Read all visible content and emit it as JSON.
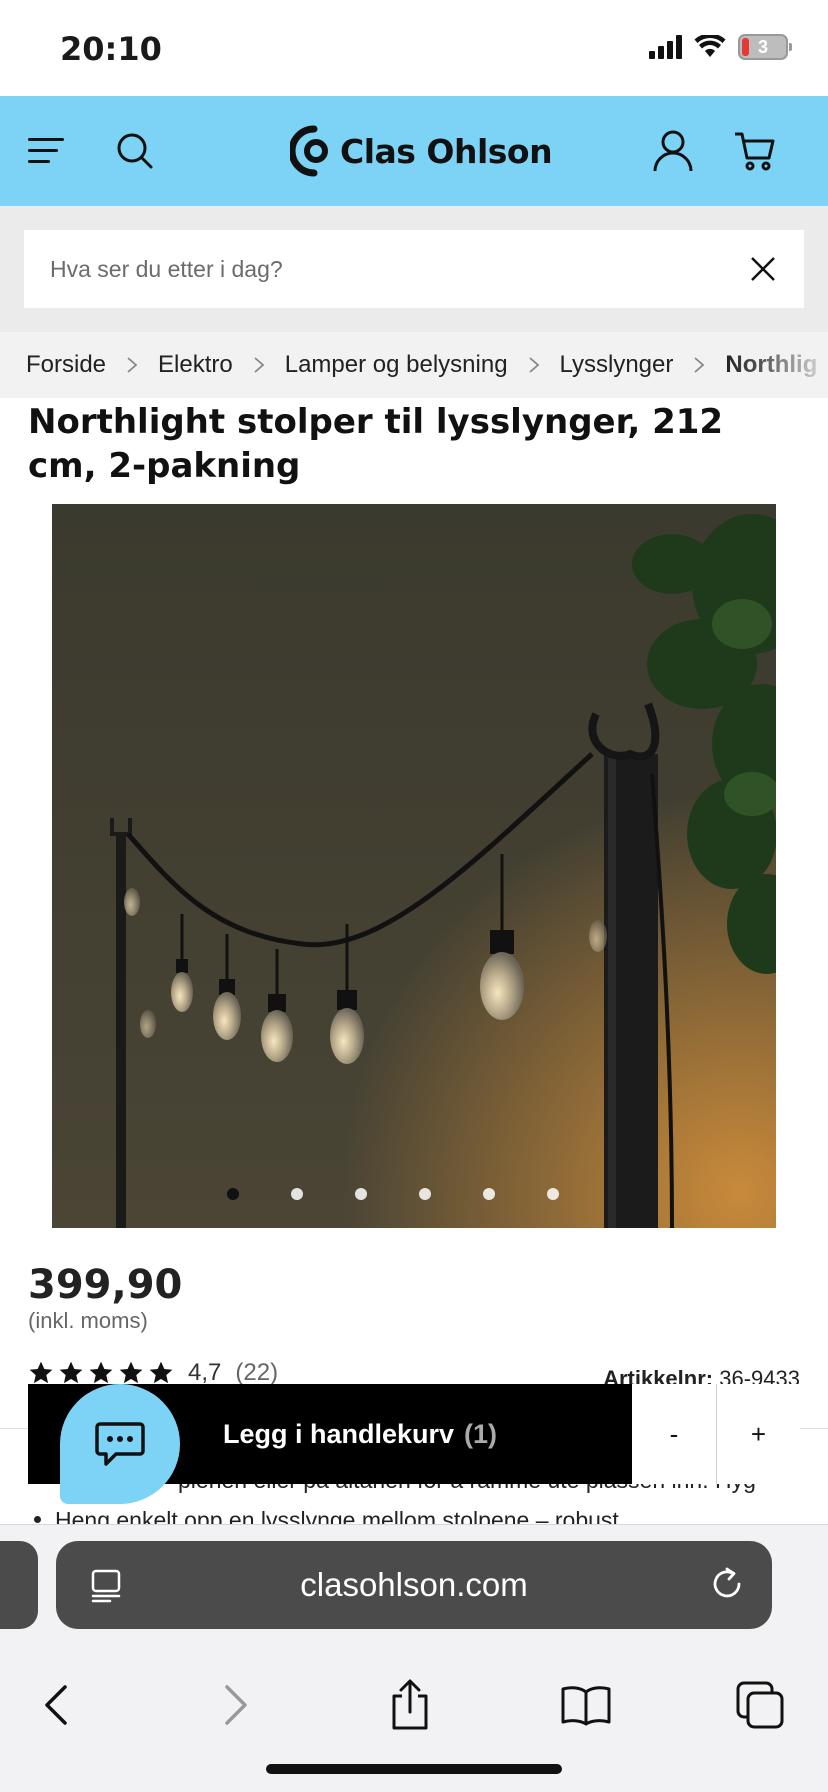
{
  "status_bar": {
    "time": "20:10",
    "battery_level": "3"
  },
  "header": {
    "logo_text": "Clas Ohlson",
    "brand_color": "#7dd3f6"
  },
  "search": {
    "placeholder": "Hva ser du etter i dag?"
  },
  "breadcrumb": [
    "Forside",
    "Elektro",
    "Lamper og belysning",
    "Lysslynger",
    "Northlig"
  ],
  "product": {
    "title": "Northlight stolper til lysslynger, 212 cm, 2-pakning",
    "price": "399,90",
    "vat_note": "(inkl. moms)",
    "rating": "4,7",
    "review_count": "(22)",
    "star_count": 5,
    "article_label": "Artikkelnr:",
    "article_number": "36-9433",
    "image_count": 6,
    "active_image": 1
  },
  "bullets": [
    "plenen eller på altanen for å ramme ute plassen inn. Hyg",
    "Heng enkelt opp en lysslynge mellom stolpene – robust"
  ],
  "cart": {
    "label": "Legg i handlekurv",
    "count": "(1)",
    "minus": "-",
    "plus": "+"
  },
  "browser": {
    "url": "clasohlson.com"
  },
  "icons": [
    "menu-icon",
    "search-icon",
    "user-icon",
    "cart-icon",
    "close-icon",
    "chat-icon",
    "reader-icon",
    "reload-icon",
    "back-icon",
    "forward-icon",
    "share-icon",
    "bookmarks-icon",
    "tabs-icon"
  ]
}
